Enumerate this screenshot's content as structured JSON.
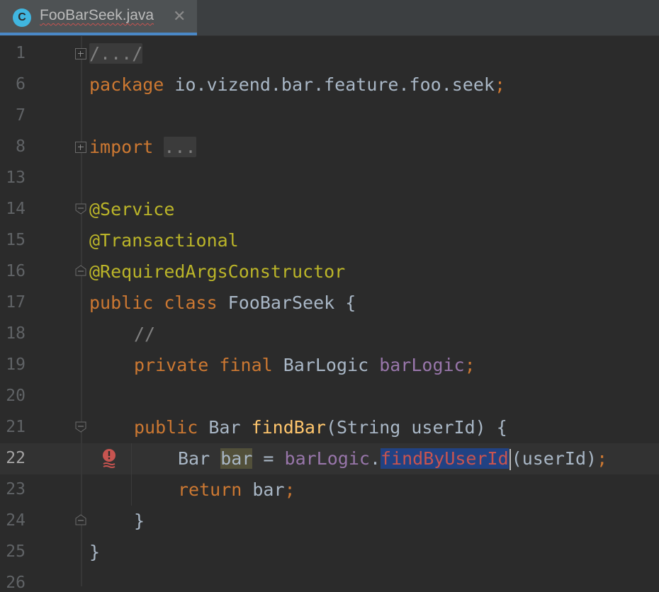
{
  "tab": {
    "icon_letter": "C",
    "file_name": "FooBarSeek.java",
    "close_glyph": "✕"
  },
  "gutter": {
    "line_numbers": [
      "1",
      "6",
      "7",
      "8",
      "13",
      "14",
      "15",
      "16",
      "17",
      "18",
      "19",
      "20",
      "21",
      "22",
      "23",
      "24",
      "25",
      "26"
    ],
    "current_line": "22"
  },
  "code": {
    "l1_fold": "/.../",
    "l6_kw": "package",
    "l6_pkg": " io.vizend.bar.feature.foo.seek",
    "l6_semi": ";",
    "l8_kw": "import",
    "l8_fold": "...",
    "l14": "@Service",
    "l15": "@Transactional",
    "l16": "@RequiredArgsConstructor",
    "l17_kw": "public class",
    "l17_rest": " FooBarSeek {",
    "l18": "//",
    "l19_kw": "private final",
    "l19_type": " BarLogic ",
    "l19_field": "barLogic",
    "l19_semi": ";",
    "l21_kw": "public",
    "l21_type": " Bar ",
    "l21_fn": "findBar",
    "l21_rest": "(String userId) {",
    "l22_type": "Bar ",
    "l22_var": "bar",
    "l22_eq": " = ",
    "l22_field": "barLogic",
    "l22_dot": ".",
    "l22_method": "findByUserId",
    "l22_args": "(userId)",
    "l22_semi": ";",
    "l23_kw": "return",
    "l23_rest": " bar",
    "l23_semi": ";",
    "l24": "}",
    "l25": "}"
  },
  "colors": {
    "background": "#2b2b2b",
    "keyword": "#cc7832",
    "annotation": "#bbb529",
    "field": "#9876aa",
    "method_decl": "#ffc66d",
    "error": "#c75450",
    "selection": "#214283"
  },
  "icons": {
    "tab_class": "class-icon",
    "error_marker": "error-icon"
  }
}
